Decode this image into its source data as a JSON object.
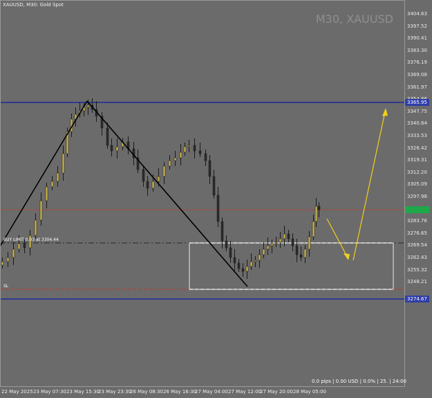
{
  "chart_info": {
    "symbol_line": "XAUUSD, M30:  Gold Spot",
    "watermark": "M30, XAUUSD"
  },
  "price_axis": {
    "ticks": [
      "3404.63",
      "3397.52",
      "3390.41",
      "3383.30",
      "3376.19",
      "3369.08",
      "3361.97",
      "3354.86",
      "3347.75",
      "3340.64",
      "3333.53",
      "3326.42",
      "3319.31",
      "3312.20",
      "3305.09",
      "3297.98",
      "3290.87",
      "3283.76",
      "3276.65",
      "3269.54",
      "3262.43",
      "3255.32",
      "3248.21"
    ],
    "resistance_label": "3365.95",
    "support_label": "3274.67",
    "current_price_label": "",
    "colors": {
      "resistance": "#2e3da8",
      "support": "#2e3da8",
      "current": "#1fa84a"
    }
  },
  "time_axis": {
    "labels": [
      "22 May 2025",
      "23 May 07:30",
      "23 May 15:30",
      "23 May 23:30",
      "26 May 08:30",
      "26 May 16:30",
      "27 May 04:00",
      "27 May 12:00",
      "27 May 20:00",
      "28 May 05:00"
    ]
  },
  "order": {
    "label": "BUY LIMIT 0.03 at 3304.44",
    "sl_label": "SL"
  },
  "status": {
    "text": "0.0 pips | 0.00 USD | 0.0% | 25. | 24:00"
  },
  "colors": {
    "background": "#6b6b6b",
    "bull_candle": "#c8b04a",
    "bear_candle": "#2b2b2b",
    "trendline": "#000000",
    "arrow": "#f2d11a",
    "horizontal_level": "#1a2a9a"
  }
}
